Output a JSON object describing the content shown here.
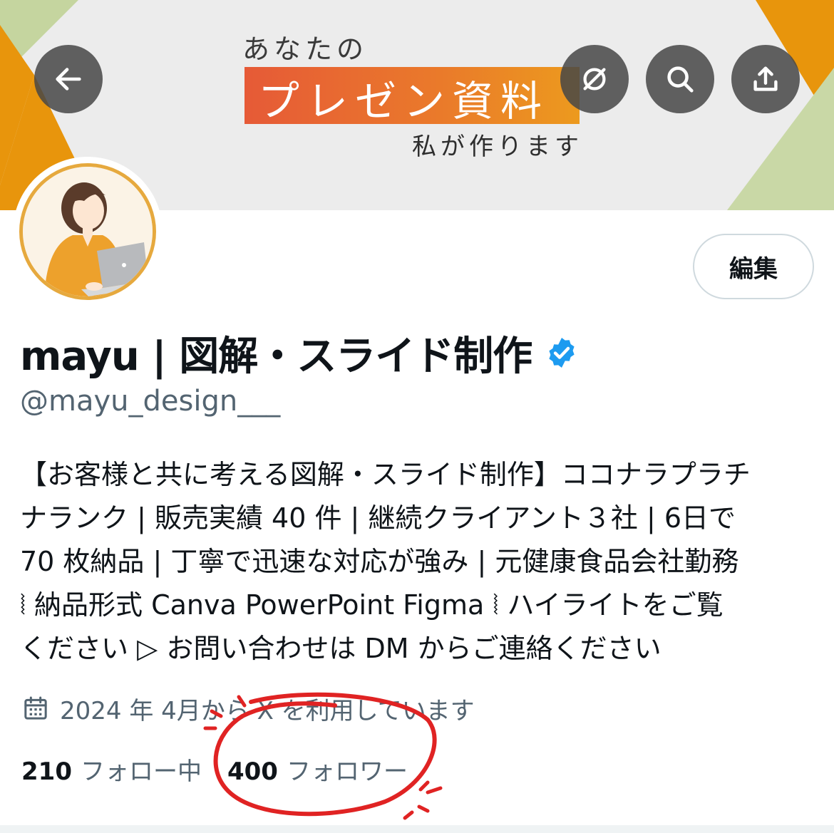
{
  "banner": {
    "line1": "あなたの",
    "line2": "プレゼン資料",
    "line3": "私が作ります",
    "colors": {
      "orange": "#e8950c",
      "green": "#c9d8a6",
      "highlight_start": "#e65a37",
      "highlight_end": "#ec9a1e"
    }
  },
  "toolbar": {
    "back_icon": "arrow-left-icon",
    "filter_icon": "slashed-circle-icon",
    "search_icon": "search-icon",
    "share_icon": "share-upload-icon"
  },
  "profile": {
    "display_name": "mayu | 図解・スライド制作",
    "handle": "@mayu_design___",
    "verified_color": "#1d9bf0",
    "edit_label": "編集",
    "bio_lines": [
      "【お客様と共に考える図解・スライド制作】ココナラプラチ",
      "ナランク | 販売実績 40 件 | 継続クライアント３社 | 6日で",
      "70 枚納品 | 丁寧で迅速な対応が強み | 元健康食品会社勤務",
      "⦚ 納品形式 Canva PowerPoint Figma ⦚ ハイライトをご覧",
      "ください ▷ お問い合わせは DM からご連絡ください"
    ],
    "joined_icon": "calendar-icon",
    "joined": "2024 年 4月から X を利用しています",
    "following_count": "210",
    "following_label": "フォロー中",
    "followers_count": "400",
    "followers_label": "フォロワー"
  },
  "annotation": {
    "color": "#e02323",
    "target": "followers"
  }
}
